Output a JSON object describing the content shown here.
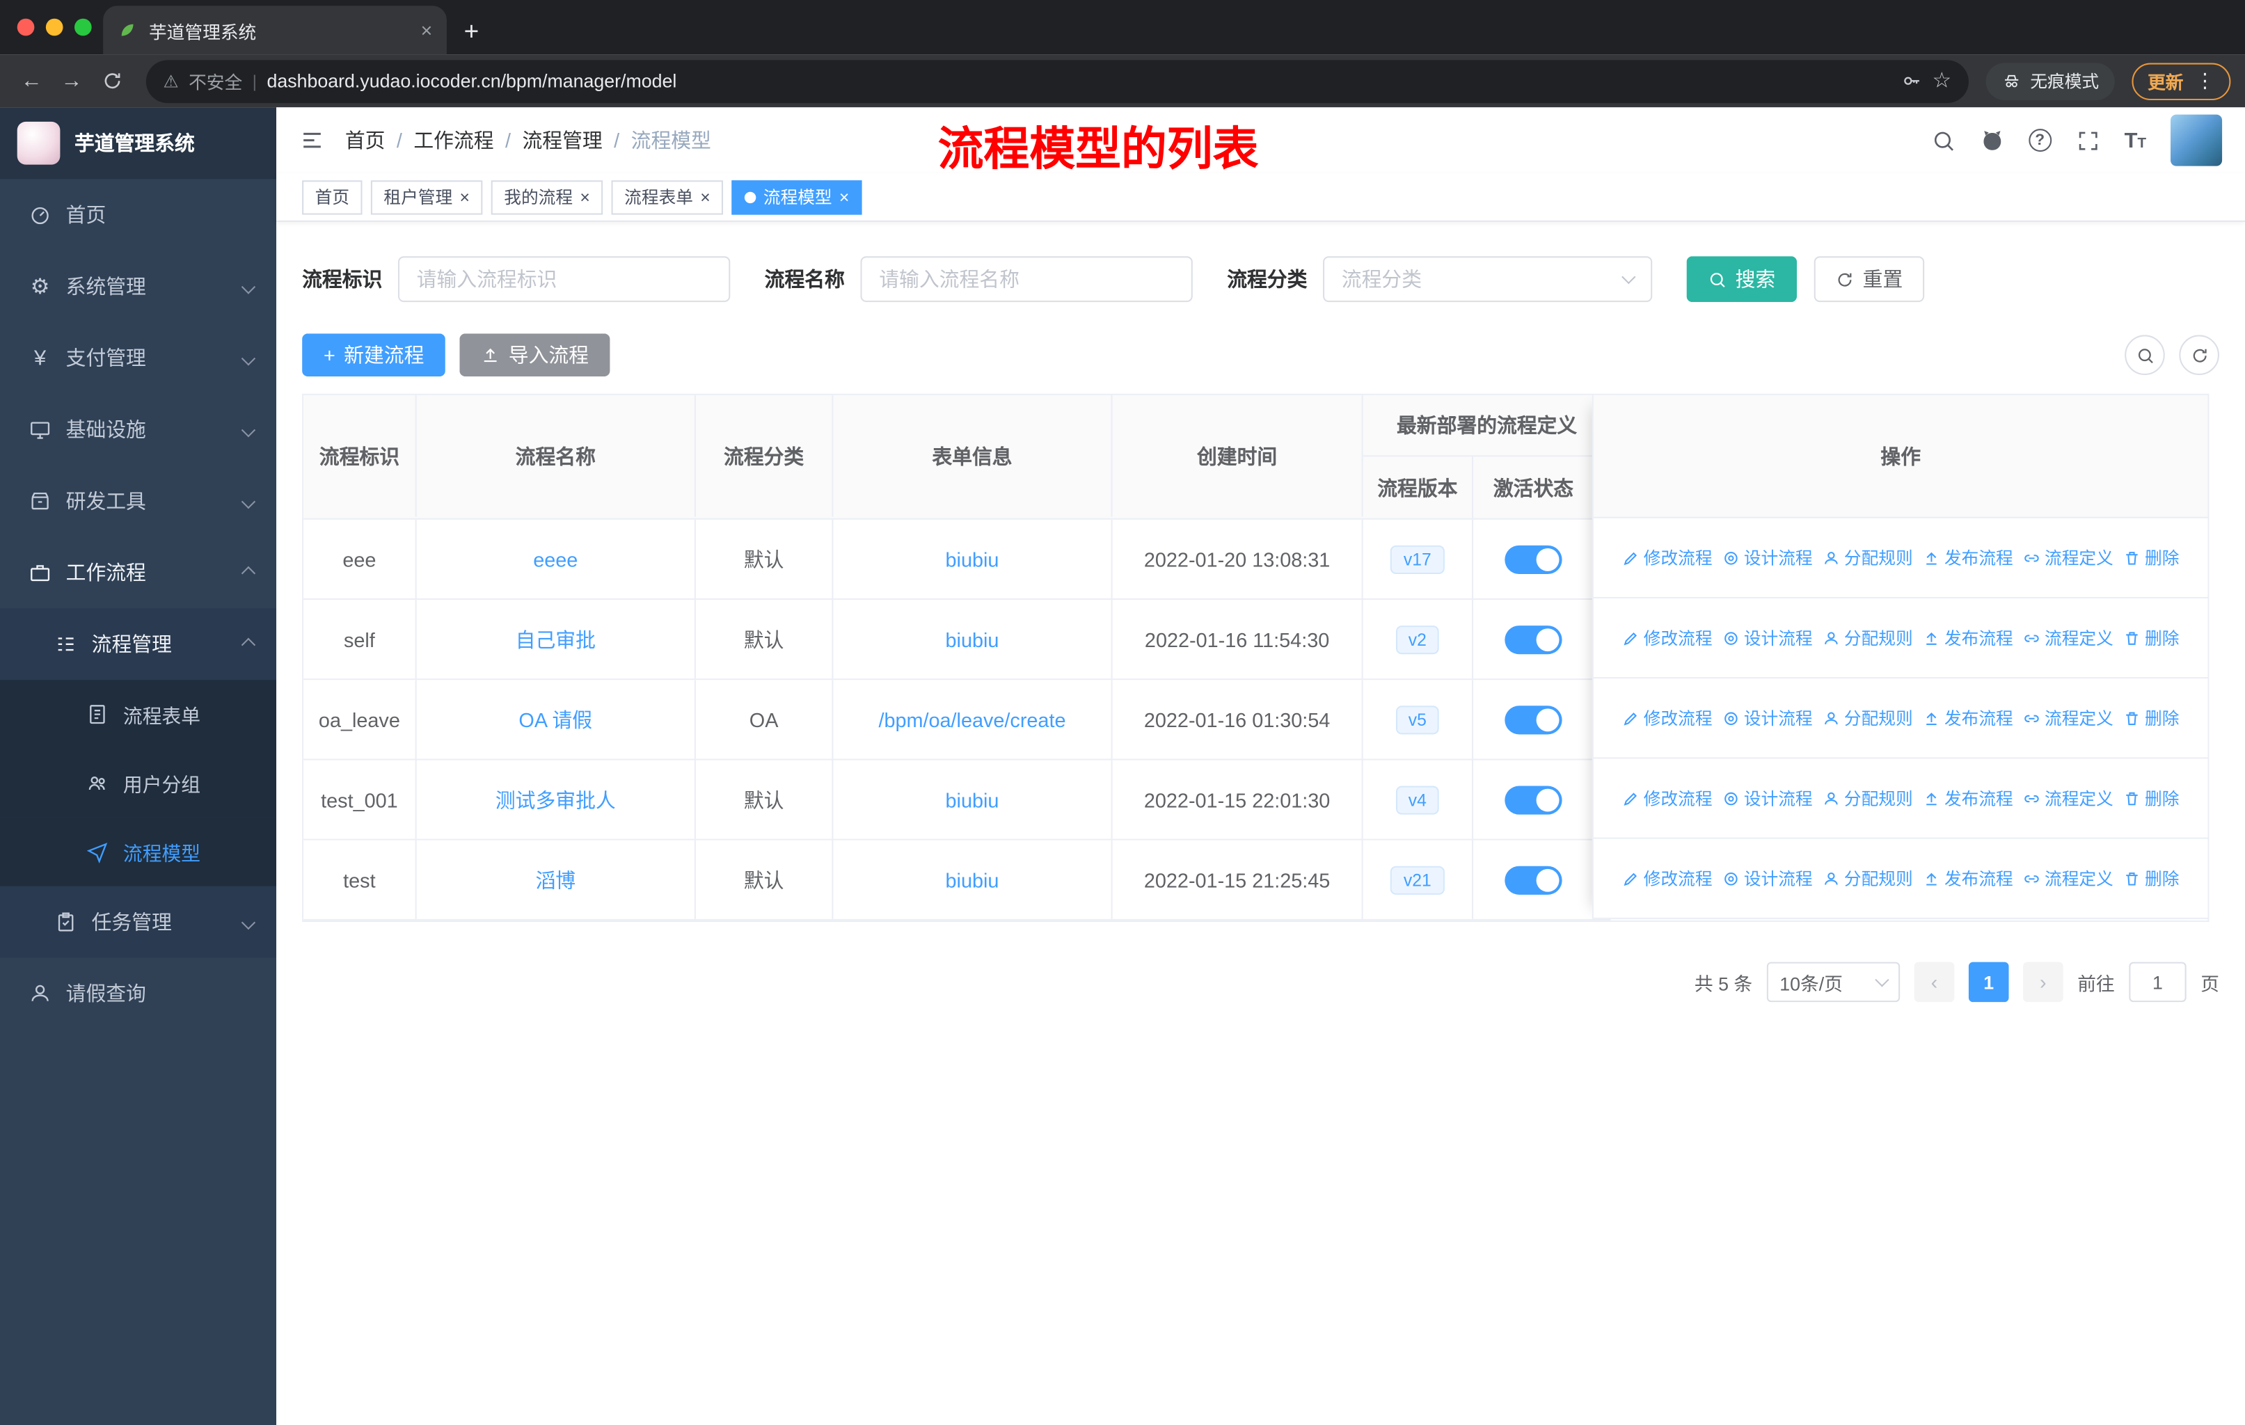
{
  "browser": {
    "tab_title": "芋道管理系统",
    "security": "不安全",
    "url": "dashboard.yudao.iocoder.cn/bpm/manager/model",
    "incognito": "无痕模式",
    "update": "更新"
  },
  "icons": {
    "close": "×",
    "back": "←",
    "forward": "→",
    "star": "☆",
    "warning": "⚠",
    "divider": "|",
    "menu_dots": "⋮",
    "plus": "+",
    "yen": "¥",
    "gear": "⚙",
    "question": "?",
    "font_large": "T",
    "font_small": "T",
    "prev": "‹",
    "next": "›"
  },
  "sidebar": {
    "logo": "芋道管理系统",
    "home": "首页",
    "system": "系统管理",
    "payment": "支付管理",
    "infra": "基础设施",
    "devtools": "研发工具",
    "workflow": "工作流程",
    "process_mgmt": "流程管理",
    "process_form": "流程表单",
    "user_group": "用户分组",
    "process_model": "流程模型",
    "task_mgmt": "任务管理",
    "leave_query": "请假查询"
  },
  "header": {
    "breadcrumb": [
      "首页",
      "工作流程",
      "流程管理",
      "流程模型"
    ],
    "separator": "/",
    "annotation": "流程模型的列表"
  },
  "tags": [
    {
      "label": "首页",
      "closable": false,
      "active": false
    },
    {
      "label": "租户管理",
      "closable": true,
      "active": false
    },
    {
      "label": "我的流程",
      "closable": true,
      "active": false
    },
    {
      "label": "流程表单",
      "closable": true,
      "active": false
    },
    {
      "label": "流程模型",
      "closable": true,
      "active": true
    }
  ],
  "filters": {
    "fields": [
      {
        "label": "流程标识",
        "placeholder": "请输入流程标识"
      },
      {
        "label": "流程名称",
        "placeholder": "请输入流程名称"
      },
      {
        "label": "流程分类",
        "placeholder": "流程分类"
      }
    ],
    "search": "搜索",
    "reset": "重置"
  },
  "toolbar": {
    "create": "新建流程",
    "import": "导入流程"
  },
  "table": {
    "columns": {
      "id": "流程标识",
      "name": "流程名称",
      "category": "流程分类",
      "form": "表单信息",
      "created": "创建时间",
      "group": "最新部署的流程定义",
      "version": "流程版本",
      "active": "激活状态",
      "ops": "操作"
    },
    "actions": [
      {
        "name": "edit",
        "label": "修改流程"
      },
      {
        "name": "design",
        "label": "设计流程"
      },
      {
        "name": "assign",
        "label": "分配规则"
      },
      {
        "name": "publish",
        "label": "发布流程"
      },
      {
        "name": "definition",
        "label": "流程定义"
      },
      {
        "name": "delete",
        "label": "删除"
      }
    ],
    "rows": [
      {
        "id": "eee",
        "name": "eeee",
        "category": "默认",
        "form": "biubiu",
        "created": "2022-01-20 13:08:31",
        "version": "v17",
        "active": true
      },
      {
        "id": "self",
        "name": "自己审批",
        "category": "默认",
        "form": "biubiu",
        "created": "2022-01-16 11:54:30",
        "version": "v2",
        "active": true
      },
      {
        "id": "oa_leave",
        "name": "OA 请假",
        "category": "OA",
        "form": "/bpm/oa/leave/create",
        "created": "2022-01-16 01:30:54",
        "version": "v5",
        "active": true
      },
      {
        "id": "test_001",
        "name": "测试多审批人",
        "category": "默认",
        "form": "biubiu",
        "created": "2022-01-15 22:01:30",
        "version": "v4",
        "active": true
      },
      {
        "id": "test",
        "name": "滔博",
        "category": "默认",
        "form": "biubiu",
        "created": "2022-01-15 21:25:45",
        "version": "v21",
        "active": true
      }
    ]
  },
  "pagination": {
    "total": "共 5 条",
    "page_size": "10条/页",
    "page": "1",
    "goto": "前往",
    "goto_value": "1",
    "unit": "页"
  },
  "colors": {
    "primary": "#409eff",
    "search_button": "#2bb7a3",
    "sidebar_bg": "#304156",
    "annotation": "#fe0000",
    "active_tag": "#409eff"
  }
}
